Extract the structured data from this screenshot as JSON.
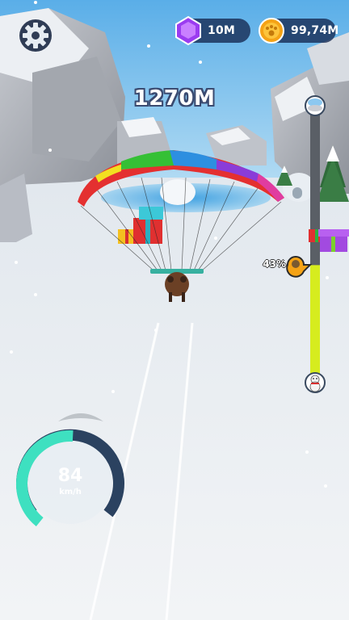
{
  "hud": {
    "gems": "10M",
    "coins": "99,74M",
    "distance": "1270M"
  },
  "progress": {
    "label": "43%",
    "fraction": 0.43
  },
  "speedometer": {
    "value": "84",
    "unit": "km/h",
    "fill_fraction": 0.55
  },
  "icons": {
    "settings": "gear-icon",
    "gem": "gem-icon",
    "coin": "coin-icon",
    "start_marker": "snowman-icon",
    "end_marker": "goal-icon",
    "checkpoint": "gift-icon",
    "player": "player-marker-icon"
  },
  "colors": {
    "pill_bg": "#14285099",
    "gem": "#9b3cf0",
    "coin": "#f5a316",
    "progress_fill": "#d6ec1e",
    "progress_track": "#5a5f66",
    "gauge_fill": "#3ee0c0",
    "gauge_track": "#2b4260",
    "sky": "#8cc8f0",
    "snow": "#eef2f5"
  }
}
